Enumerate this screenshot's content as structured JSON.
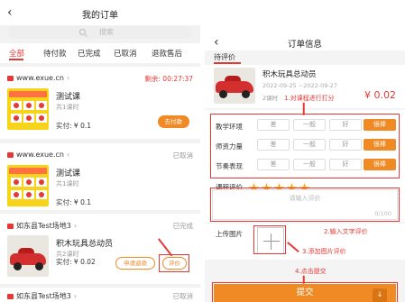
{
  "left": {
    "title": "我的订单",
    "back_icon": "‹",
    "search_placeholder": "搜索",
    "tabs": [
      "全部",
      "待付款",
      "已完成",
      "已取消",
      "退款售后"
    ],
    "orders": [
      {
        "shop": "www.exue.cn",
        "status": "剩余: 00:27:37",
        "product": "测试课",
        "lessons": "共1课时",
        "payment": "实付: ¥ 0.1",
        "button": "去付款"
      },
      {
        "shop": "www.exue.cn",
        "status": "已取消",
        "product": "测试课",
        "lessons": "共1课时",
        "payment": "实付: ¥ 0.1"
      },
      {
        "shop": "如东县Test场地3",
        "status": "已完成",
        "product": "积木玩具总动员",
        "lessons": "共2课时",
        "payment": "实付: ¥ 0.02",
        "refund_button": "申请退款",
        "review_button": "评价"
      },
      {
        "shop": "如东县Test场地3",
        "status": "已取消"
      }
    ]
  },
  "right": {
    "title": "订单信息",
    "back_icon": "‹",
    "pending_label": "待评价",
    "product": {
      "name": "积木玩具总动员",
      "date": "2022-09-25 ~2022-09-27",
      "lessons": "2课时",
      "price": "¥ 0.02"
    },
    "ratings": [
      {
        "label": "教学环境",
        "options": [
          "差",
          "一般",
          "好",
          "很棒"
        ],
        "selected": "很棒"
      },
      {
        "label": "师资力量",
        "options": [
          "差",
          "一般",
          "好",
          "很棒"
        ],
        "selected": "很棒"
      },
      {
        "label": "节奏表现",
        "options": [
          "差",
          "一般",
          "好",
          "很棒"
        ],
        "selected": "很棒"
      }
    ],
    "course_rating_label": "课程评价",
    "course_rating_stars": 5,
    "comment_placeholder": "请输入评价",
    "comment_count": "0/100",
    "upload_label": "上传图片",
    "submit_label": "提交",
    "submit_icon": "↓"
  },
  "annotations": {
    "step1": "1.对课程进行打分",
    "step2": "2.输入文字评价",
    "step3": "3.添加图片评价",
    "step4": "4.点击提交"
  },
  "colors": {
    "accent_orange": "#f08a24",
    "accent_red": "#e53935",
    "star": "#f5a623"
  }
}
